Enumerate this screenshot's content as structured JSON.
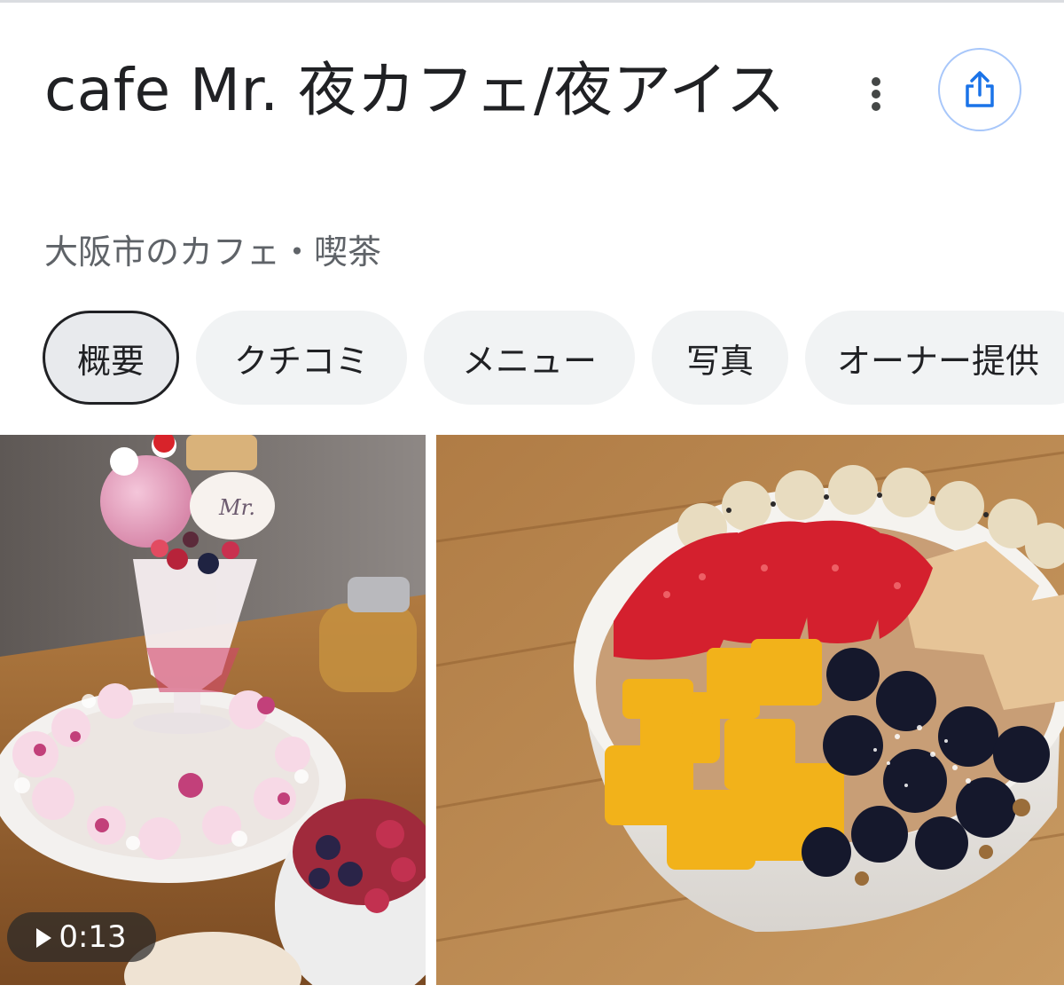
{
  "place": {
    "title": "cafe Mr. 夜カフェ/夜アイス",
    "subtitle": "大阪市のカフェ・喫茶"
  },
  "header_actions": {
    "more_icon": "more-vertical-icon",
    "share_icon": "share-icon"
  },
  "tabs": [
    {
      "label": "概要",
      "active": true
    },
    {
      "label": "クチコミ",
      "active": false
    },
    {
      "label": "メニュー",
      "active": false
    },
    {
      "label": "写真",
      "active": false
    },
    {
      "label": "オーナー提供",
      "active": false
    }
  ],
  "photos": {
    "video_duration": "0:13",
    "plate_text": "Mr."
  },
  "colors": {
    "title": "#202124",
    "subtitle": "#5f6368",
    "chip_bg": "#f1f3f4",
    "share_border": "#a8c7fa",
    "share_icon": "#1a73e8"
  }
}
